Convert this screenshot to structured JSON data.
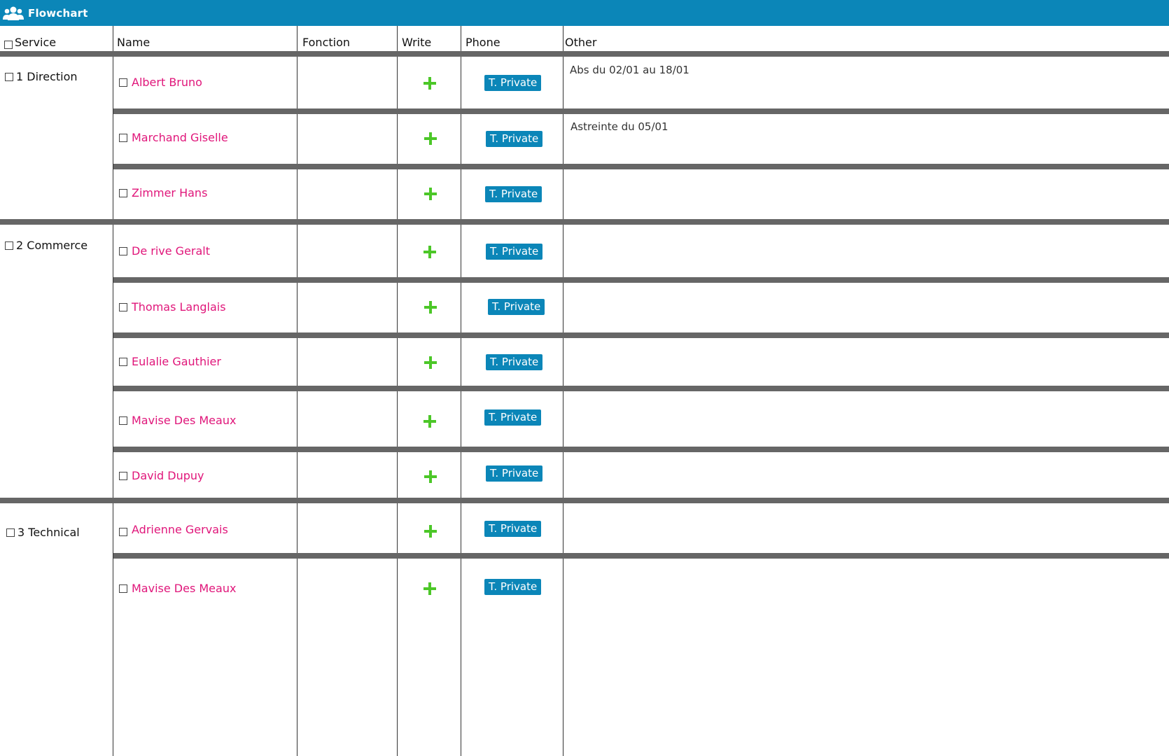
{
  "app": {
    "title": "Flowchart",
    "icon": "users-icon"
  },
  "columns": {
    "service": "Service",
    "name": "Name",
    "fonction": "Fonction",
    "write": "Write",
    "phone": "Phone",
    "other": "Other"
  },
  "services": [
    {
      "label": "1 Direction"
    },
    {
      "label": "2 Commerce"
    },
    {
      "label": "3 Technical"
    }
  ],
  "rows": [
    {
      "name": "Albert Bruno",
      "fonction": "",
      "phone": "T. Private",
      "other": "Abs du 02/01 au 18/01"
    },
    {
      "name": "Marchand Giselle",
      "fonction": "",
      "phone": "T. Private",
      "other": "Astreinte du 05/01"
    },
    {
      "name": "Zimmer Hans",
      "fonction": "",
      "phone": "T. Private",
      "other": ""
    },
    {
      "name": "De rive Geralt",
      "fonction": "",
      "phone": "T. Private",
      "other": ""
    },
    {
      "name": "Thomas Langlais",
      "fonction": "",
      "phone": "T. Private",
      "other": ""
    },
    {
      "name": "Eulalie Gauthier",
      "fonction": "",
      "phone": "T. Private",
      "other": ""
    },
    {
      "name": "Mavise Des Meaux",
      "fonction": "",
      "phone": "T. Private",
      "other": ""
    },
    {
      "name": "David Dupuy",
      "fonction": "",
      "phone": "T. Private",
      "other": ""
    },
    {
      "name": "Adrienne Gervais",
      "fonction": "",
      "phone": "T. Private",
      "other": ""
    },
    {
      "name": "Mavise Des Meaux",
      "fonction": "",
      "phone": "T. Private",
      "other": ""
    }
  ],
  "colors": {
    "titlebar": "#0b86b8",
    "name_text": "#e0167a",
    "plus_icon": "#4cc728",
    "phone_badge": "#0b86b8",
    "separator": "#666666"
  }
}
